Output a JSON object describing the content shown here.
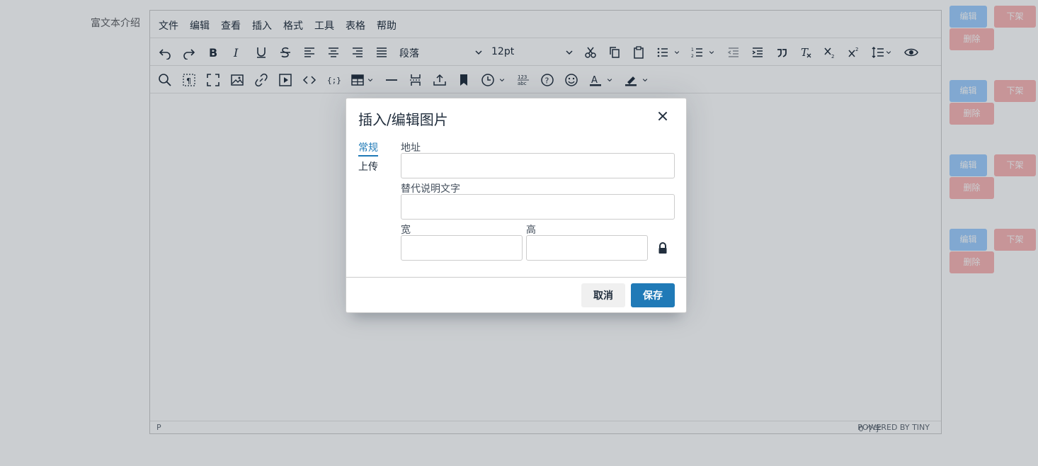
{
  "page": {
    "field_label": "富文本介绍"
  },
  "right_panel": {
    "rows": [
      {
        "edit": "编辑",
        "down": "下架",
        "delete": "删除"
      },
      {
        "edit": "编辑",
        "down": "下架",
        "delete": "删除"
      },
      {
        "edit": "编辑",
        "down": "下架",
        "delete": "删除"
      },
      {
        "edit": "编辑",
        "down": "下架",
        "delete": "删除"
      }
    ]
  },
  "editor": {
    "menubar": [
      "文件",
      "编辑",
      "查看",
      "插入",
      "格式",
      "工具",
      "表格",
      "帮助"
    ],
    "format_select": "段落",
    "size_select": "12pt",
    "statusbar": {
      "path": "P",
      "word_count": "0 个字",
      "branding": "POWERED BY TINY"
    }
  },
  "dialog": {
    "title": "插入/编辑图片",
    "tabs": [
      "常规",
      "上传"
    ],
    "active_tab": "常规",
    "fields": {
      "source_label": "地址",
      "source_value": "",
      "alt_label": "替代说明文字",
      "alt_value": "",
      "width_label": "宽",
      "width_value": "",
      "height_label": "高",
      "height_value": ""
    },
    "cancel_label": "取消",
    "save_label": "保存",
    "accent_color": "#207ab7"
  }
}
